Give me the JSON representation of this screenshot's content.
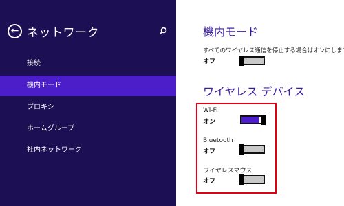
{
  "sidebar": {
    "title": "ネットワーク",
    "items": [
      {
        "label": "接続",
        "selected": false
      },
      {
        "label": "機内モード",
        "selected": true
      },
      {
        "label": "プロキシ",
        "selected": false
      },
      {
        "label": "ホームグループ",
        "selected": false
      },
      {
        "label": "社内ネットワーク",
        "selected": false
      }
    ],
    "back_icon": "back-arrow-circle-icon",
    "search_icon": "search-icon"
  },
  "airplane": {
    "title": "機内モード",
    "description": "すべてのワイヤレス通信を停止する場合はオンにします",
    "state": "オフ",
    "on": false
  },
  "wireless": {
    "title": "ワイヤレス デバイス",
    "devices": [
      {
        "name": "Wi-Fi",
        "state": "オン",
        "on": true
      },
      {
        "name": "Bluetooth",
        "state": "オフ",
        "on": false
      },
      {
        "name": "ワイヤレスマウス",
        "state": "オフ",
        "on": false
      }
    ]
  },
  "colors": {
    "sidebar_bg": "#1c0f54",
    "selected_bg": "#4b1ec9",
    "accent": "#4b1ec9",
    "title_color": "#3d1ea6",
    "highlight_border": "#e00010"
  }
}
